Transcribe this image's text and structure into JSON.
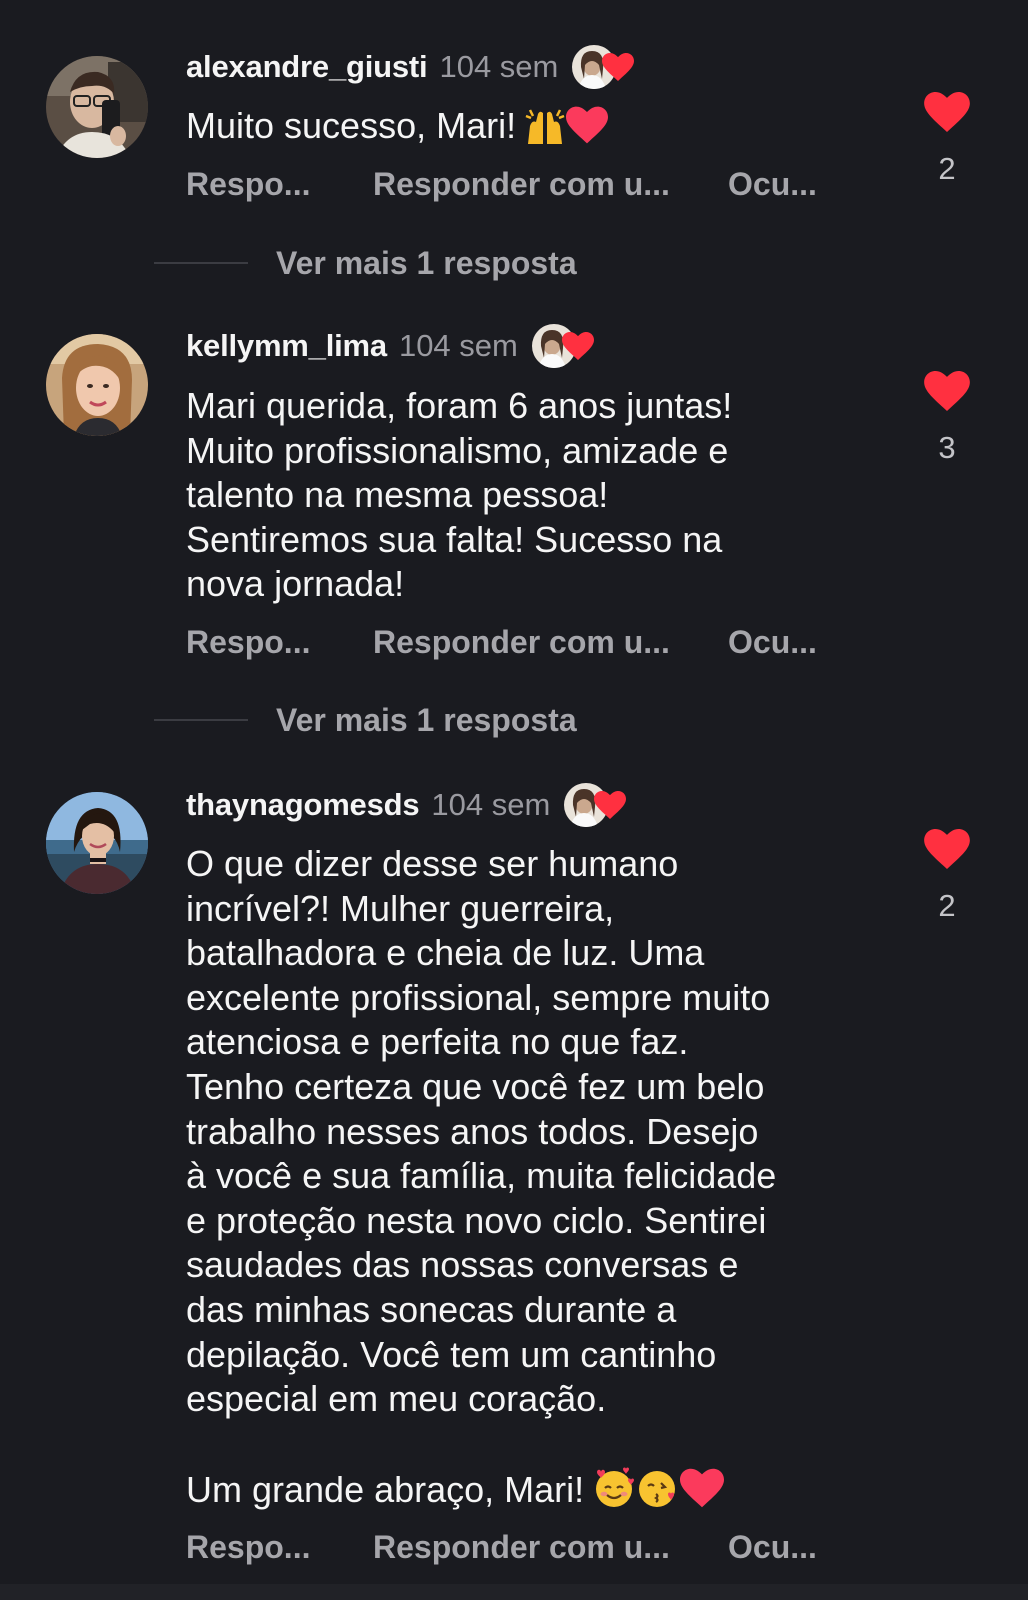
{
  "comments": [
    {
      "username": "alexandre_giusti",
      "time": "104 sem",
      "lines": [
        "Muito sucesso, Mari!"
      ],
      "trailing_emojis": [
        "raising-hands-emoji",
        "red-heart-emoji"
      ],
      "like_count": "2",
      "actions": {
        "reply": "Respo...",
        "reply_with": "Responder com u...",
        "hide": "Ocu..."
      },
      "more_replies": "Ver mais 1 resposta"
    },
    {
      "username": "kellymm_lima",
      "time": "104 sem",
      "lines": [
        "Mari querida, foram 6 anos juntas!",
        "Muito profissionalismo, amizade e",
        "talento na mesma pessoa!",
        "Sentiremos sua falta! Sucesso na",
        "nova jornada!"
      ],
      "like_count": "3",
      "actions": {
        "reply": "Respo...",
        "reply_with": "Responder com u...",
        "hide": "Ocu..."
      },
      "more_replies": "Ver mais 1 resposta"
    },
    {
      "username": "thaynagomesds",
      "time": "104 sem",
      "lines": [
        "O que dizer desse ser humano",
        "incrível?! Mulher guerreira,",
        "batalhadora e cheia de luz. Uma",
        "excelente profissional, sempre muito",
        "atenciosa e perfeita no que faz.",
        "Tenho certeza que você fez um belo",
        "trabalho nesses anos todos. Desejo",
        "à você e sua família, muita felicidade",
        "e proteção nesta novo ciclo. Sentirei",
        "saudades das nossas conversas e",
        "das minhas sonecas durante a",
        "depilação. Você tem um cantinho",
        "especial em meu coração.",
        "",
        "Um grande abraço, Mari!"
      ],
      "trailing_emojis": [
        "smiling-face-with-hearts-emoji",
        "face-blowing-kiss-emoji",
        "red-heart-emoji"
      ],
      "like_count": "2",
      "actions": {
        "reply": "Respo...",
        "reply_with": "Responder com u...",
        "hide": "Ocu..."
      }
    }
  ],
  "colors": {
    "background": "#1a1b20",
    "text": "#f5f5f5",
    "muted": "#a6a6ab",
    "heart": "#ff3040"
  }
}
